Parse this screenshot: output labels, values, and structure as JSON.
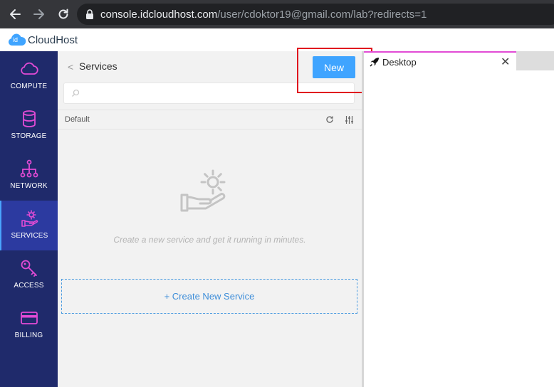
{
  "browser": {
    "url_host": "console.idcloudhost.com",
    "url_path": "/user/cdoktor19@gmail.com/lab?redirects=1"
  },
  "app": {
    "logo_badge": "id",
    "logo_name": "CloudHost"
  },
  "sidebar": {
    "items": [
      {
        "label": "COMPUTE",
        "icon": "cloud-icon"
      },
      {
        "label": "STORAGE",
        "icon": "database-icon"
      },
      {
        "label": "NETWORK",
        "icon": "network-icon"
      },
      {
        "label": "SERVICES",
        "icon": "services-icon",
        "active": true
      },
      {
        "label": "ACCESS",
        "icon": "key-icon"
      },
      {
        "label": "BILLING",
        "icon": "card-icon"
      }
    ],
    "icon_color": "#e24bd5"
  },
  "panel": {
    "back_glyph": "<",
    "title": "Services",
    "new_button": "New",
    "search_placeholder": "",
    "group_label": "Default",
    "empty_text": "Create a new service and get it running in minutes.",
    "create_button": "+ Create New Service"
  },
  "desktop": {
    "tab_label": "Desktop",
    "close_glyph": "✕"
  },
  "colors": {
    "accent": "#3fa4ff",
    "sidebar_bg": "#1f2a6b",
    "highlight": "#e0161f"
  }
}
